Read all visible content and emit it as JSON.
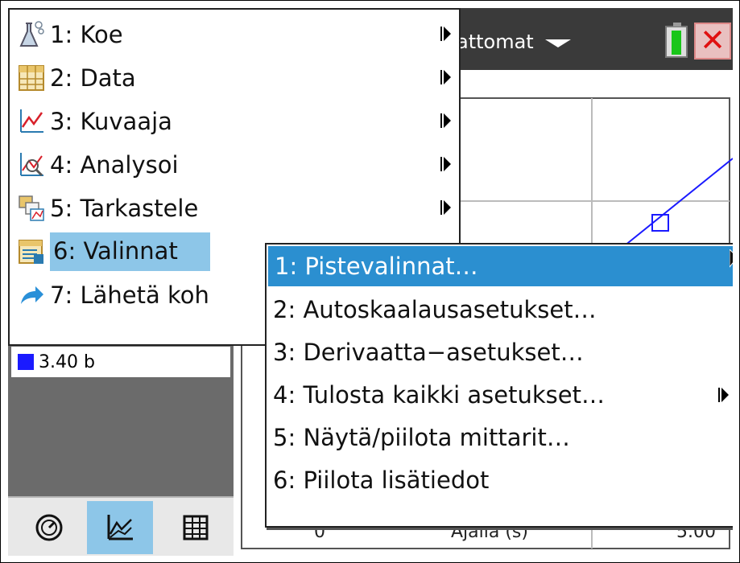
{
  "document_tab": {
    "label": "attomat"
  },
  "main_menu": {
    "items": [
      {
        "label": "1: Koe",
        "icon": "flask-icon",
        "has_submenu": true
      },
      {
        "label": "2: Data",
        "icon": "table-icon",
        "has_submenu": true
      },
      {
        "label": "3: Kuvaaja",
        "icon": "line-graph-icon",
        "has_submenu": true
      },
      {
        "label": "4: Analysoi",
        "icon": "analyze-icon",
        "has_submenu": true
      },
      {
        "label": "5: Tarkastele",
        "icon": "view-icon",
        "has_submenu": true
      },
      {
        "label": "6: Valinnat",
        "icon": "options-icon",
        "has_submenu": false,
        "selected": true
      },
      {
        "label": "7: Lähetä koh",
        "icon": "send-arrow-icon",
        "has_submenu": false
      }
    ]
  },
  "submenu": {
    "items": [
      {
        "label": "1: Pistevalinnat…",
        "selected": true
      },
      {
        "label": "2: Autoskaalausasetukset…"
      },
      {
        "label": "3: Derivaatta−asetukset…"
      },
      {
        "label": "4: Tulosta kaikki asetukset…",
        "has_submenu": true
      },
      {
        "label": "5: Näytä/piilota mittarit…"
      },
      {
        "label": "6: Piilota lisätiedot"
      }
    ]
  },
  "legend": {
    "value": "3.40 b",
    "color": "#1a1aff"
  },
  "graph": {
    "x_axis_label": "Ajalla (s)",
    "x_tick_left": "0",
    "x_tick_right": "5.00"
  },
  "bottom_bar": {
    "buttons": [
      {
        "icon": "meter-icon"
      },
      {
        "icon": "graph-view-icon",
        "active": true
      },
      {
        "icon": "table-view-icon"
      }
    ]
  },
  "colors": {
    "menu_highlight": "#8dc6e8",
    "submenu_selected": "#2b8fd0",
    "series": "#1a1aff"
  }
}
